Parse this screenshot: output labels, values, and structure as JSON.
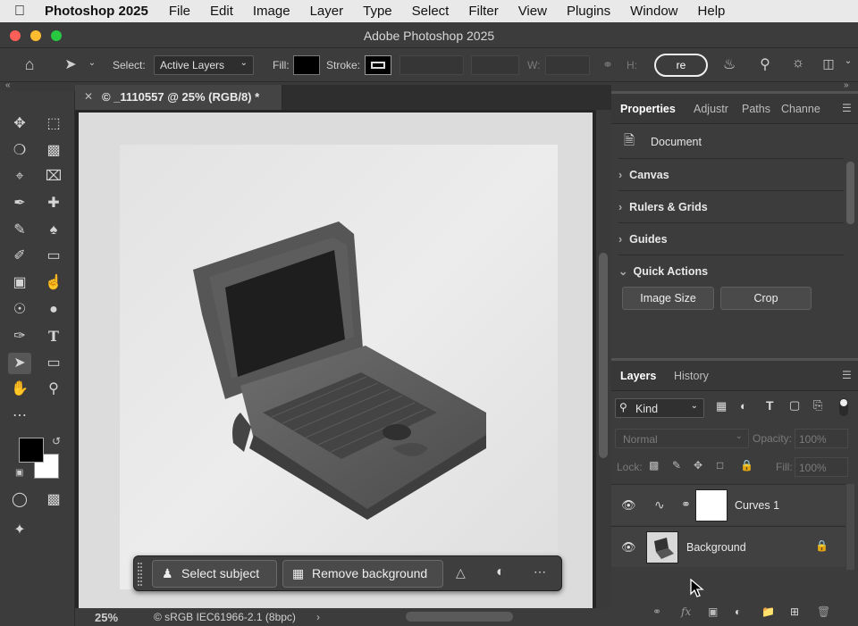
{
  "menubar": {
    "app_name": "Photoshop 2025",
    "items": [
      "File",
      "Edit",
      "Image",
      "Layer",
      "Type",
      "Select",
      "Filter",
      "View",
      "Plugins",
      "Window",
      "Help"
    ]
  },
  "window": {
    "title": "Adobe Photoshop 2025"
  },
  "options": {
    "select_label": "Select:",
    "select_value": "Active Layers",
    "fill_label": "Fill:",
    "stroke_label": "Stroke:",
    "w_label": "W:",
    "h_label": "H:",
    "pill_text": "re"
  },
  "document": {
    "tab_title": "© _1110557 @ 25% (RGB/8) *",
    "zoom": "25%",
    "profile": "© sRGB IEC61966-2.1 (8bpc)"
  },
  "taskbar": {
    "select_subject": "Select subject",
    "remove_background": "Remove background"
  },
  "properties": {
    "tabs": [
      "Properties",
      "Adjustr",
      "Paths",
      "Channe"
    ],
    "doc_label": "Document",
    "sections": [
      "Canvas",
      "Rulers & Grids",
      "Guides",
      "Quick Actions"
    ],
    "buttons": [
      "Image Size",
      "Crop"
    ]
  },
  "layers": {
    "tabs": [
      "Layers",
      "History"
    ],
    "kind_label": "Kind",
    "blend_mode": "Normal",
    "opacity_label": "Opacity:",
    "opacity_value": "100%",
    "lock_label": "Lock:",
    "fill_label": "Fill:",
    "fill_value": "100%",
    "items": [
      {
        "name": "Curves 1"
      },
      {
        "name": "Background"
      }
    ]
  },
  "colors": {
    "foreground": "#000000",
    "background": "#ffffff",
    "accent": "#ffffff"
  }
}
